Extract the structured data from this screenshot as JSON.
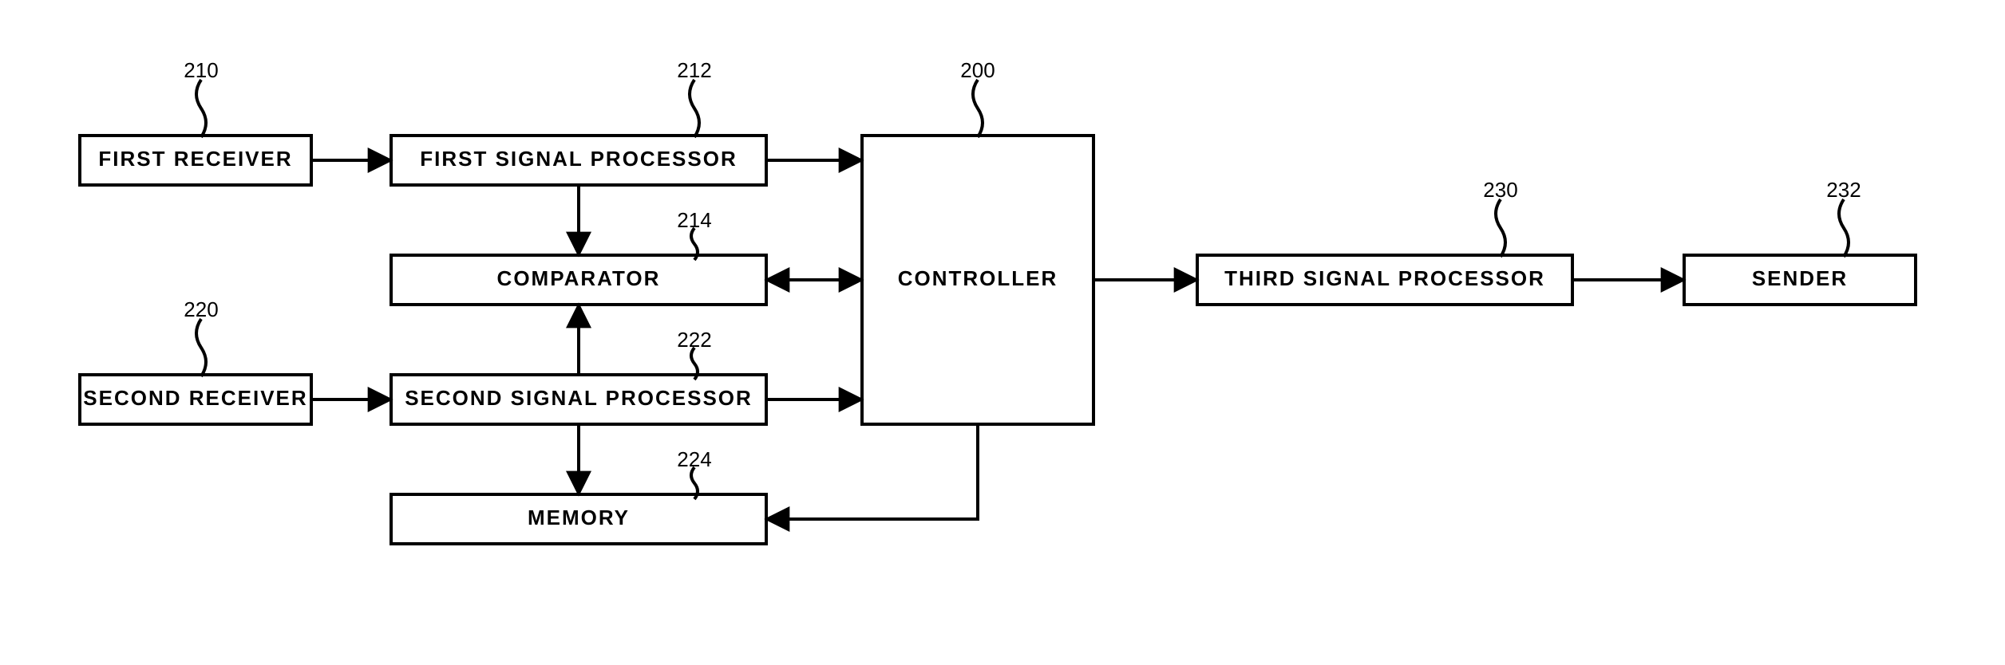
{
  "blocks": {
    "first_receiver": {
      "num": "210",
      "label": "FIRST RECEIVER"
    },
    "first_sp": {
      "num": "212",
      "label": "FIRST SIGNAL PROCESSOR"
    },
    "comparator": {
      "num": "214",
      "label": "COMPARATOR"
    },
    "second_receiver": {
      "num": "220",
      "label": "SECOND RECEIVER"
    },
    "second_sp": {
      "num": "222",
      "label": "SECOND SIGNAL PROCESSOR"
    },
    "memory": {
      "num": "224",
      "label": "MEMORY"
    },
    "controller": {
      "num": "200",
      "label": "CONTROLLER"
    },
    "third_sp": {
      "num": "230",
      "label": "THIRD SIGNAL PROCESSOR"
    },
    "sender": {
      "num": "232",
      "label": "SENDER"
    }
  }
}
